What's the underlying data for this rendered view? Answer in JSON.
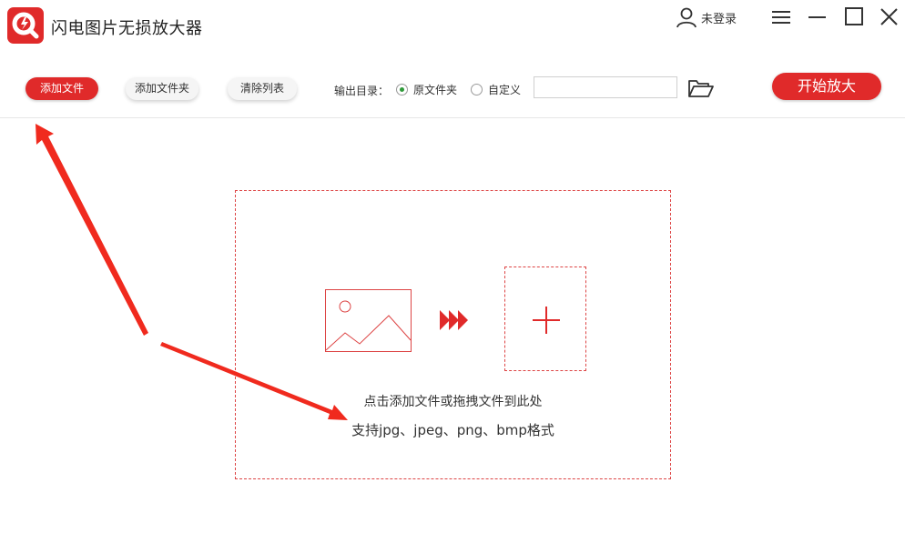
{
  "app": {
    "title": "闪电图片无损放大器",
    "logo_icon": "magnifier-logo-icon",
    "brand_color": "#e02a2a"
  },
  "window": {
    "user_label": "未登录",
    "user_icon": "user-icon",
    "menu_icon": "hamburger-icon",
    "minimize_icon": "minimize-icon",
    "maximize_icon": "maximize-icon",
    "close_icon": "close-icon"
  },
  "toolbar": {
    "add_file_label": "添加文件",
    "add_folder_label": "添加文件夹",
    "clear_list_label": "清除列表",
    "output_dir_label": "输出目录：",
    "output_options": [
      {
        "label": "原文件夹",
        "selected": true
      },
      {
        "label": "自定义",
        "selected": false
      }
    ],
    "output_path_value": "",
    "folder_icon": "folder-open-icon",
    "start_label": "开始放大"
  },
  "dropzone": {
    "hint_primary": "点击添加文件或拖拽文件到此处",
    "hint_formats": "支持jpg、jpeg、png、bmp格式",
    "image_icon": "image-icon",
    "arrows_icon": "triple-arrow-icon",
    "plus_icon": "plus-icon"
  },
  "annotation": {
    "arrow_color": "#f02a1e"
  }
}
